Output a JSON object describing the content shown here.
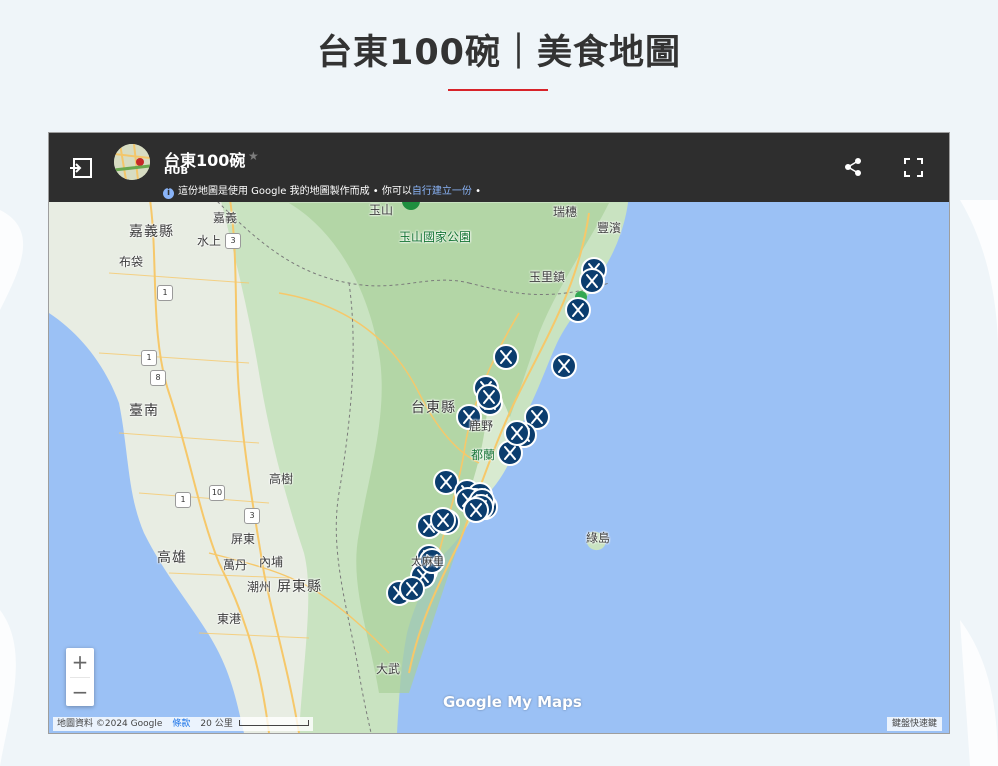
{
  "page": {
    "title": "台東100碗｜美食地圖"
  },
  "map": {
    "title": "台東100碗",
    "subtitle": "HUB",
    "notice_text": "這份地圖是使用 Google 我的地圖製作而成 • 你可以",
    "notice_link": "自行建立一份",
    "notice_end": " •",
    "icons": {
      "legend_toggle": "legend-toggle-icon",
      "share": "share-icon",
      "fullscreen": "fullscreen-icon",
      "info": "info-icon",
      "star": "star-icon",
      "marker": "restaurant-marker-icon"
    },
    "places": [
      {
        "name": "玉山"
      },
      {
        "name": "玉山國家公園"
      },
      {
        "name": "瑞穗"
      },
      {
        "name": "豐濱"
      },
      {
        "name": "嘉義縣"
      },
      {
        "name": "嘉義"
      },
      {
        "name": "水上"
      },
      {
        "name": "布袋"
      },
      {
        "name": "玉里鎮"
      },
      {
        "name": "臺南"
      },
      {
        "name": "台東縣"
      },
      {
        "name": "鹿野"
      },
      {
        "name": "都蘭"
      },
      {
        "name": "高樹"
      },
      {
        "name": "屏東"
      },
      {
        "name": "高雄"
      },
      {
        "name": "萬丹"
      },
      {
        "name": "內埔"
      },
      {
        "name": "潮州"
      },
      {
        "name": "屏東縣"
      },
      {
        "name": "綠島"
      },
      {
        "name": "東港"
      },
      {
        "name": "大武"
      },
      {
        "name": "太麻里"
      }
    ],
    "road_shields": [
      "3",
      "1",
      "1",
      "8",
      "1",
      "10",
      "3"
    ],
    "zoom_in": "+",
    "zoom_out": "−",
    "google_logo": "Google My Maps",
    "attribution": "地圖資料 ©2024 Google",
    "terms": "條款",
    "scale": "20 公里",
    "shortcuts": "鍵盤快速鍵",
    "colors": {
      "header": "#2e2e2e",
      "sea": "#9bc1f5",
      "marker": "#0b3d6e",
      "title_rule": "#d8232a",
      "link": "#8ab4f8"
    },
    "marker_count": 32
  }
}
